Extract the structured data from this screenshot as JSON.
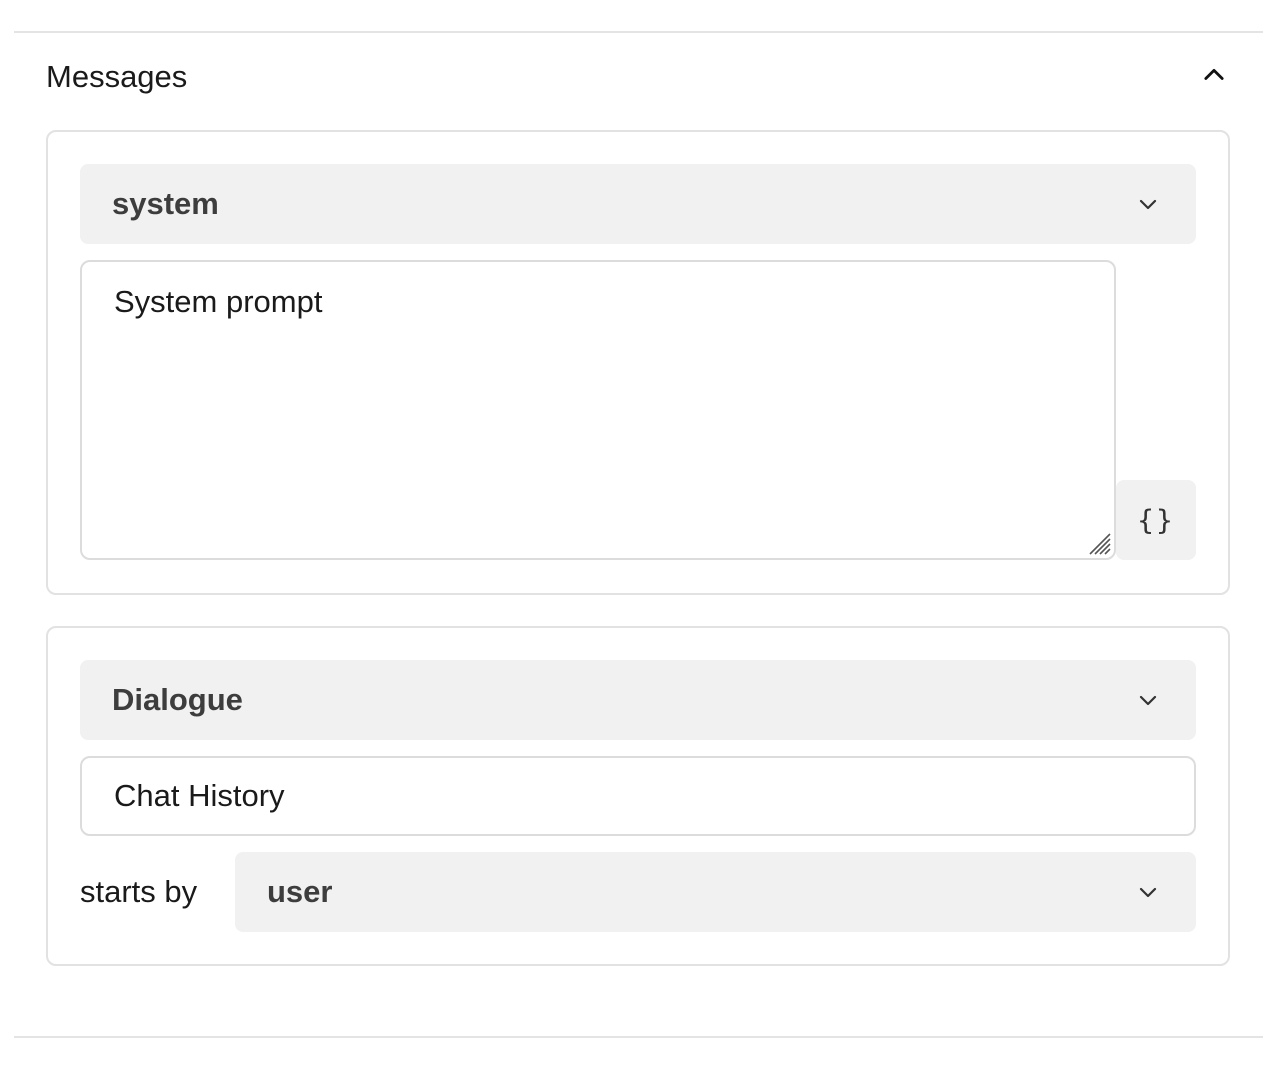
{
  "messages_section": {
    "title": "Messages",
    "collapse_icon": "chevron-up-icon"
  },
  "system_card": {
    "role_select": {
      "selected": "system",
      "icon": "chevron-down-icon"
    },
    "prompt_textarea": {
      "value": "System prompt"
    },
    "variable_button": {
      "glyph": "{}",
      "icon": "curly-braces-icon"
    }
  },
  "dialogue_card": {
    "type_select": {
      "selected": "Dialogue",
      "icon": "chevron-down-icon"
    },
    "history_input": {
      "value": "Chat History"
    },
    "starts_by": {
      "label": "starts by",
      "select": {
        "selected": "user",
        "icon": "chevron-down-icon"
      }
    }
  }
}
